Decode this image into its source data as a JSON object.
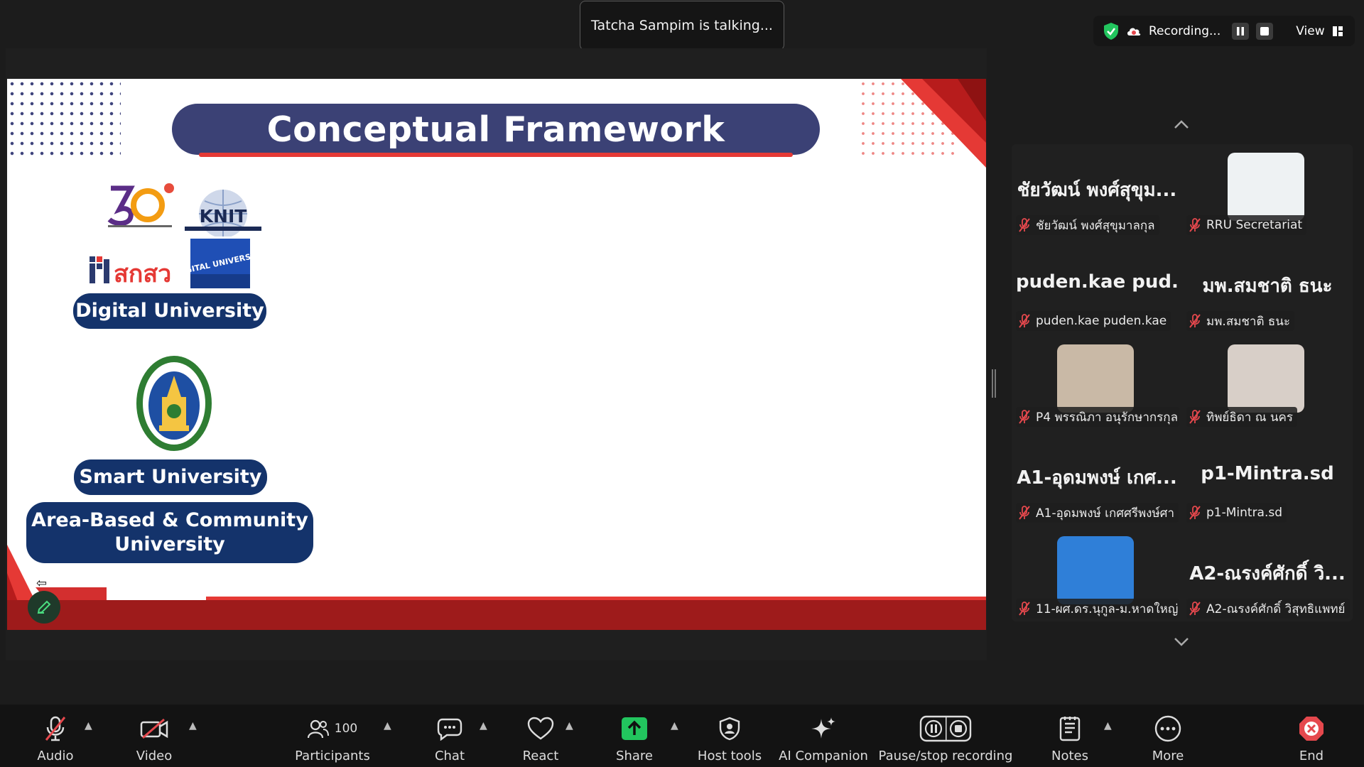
{
  "status": {
    "talking": "Tatcha Sampim is talking..."
  },
  "recording": {
    "label": "Recording...",
    "view_label": "View"
  },
  "slide": {
    "title": "Conceptual Framework",
    "logo_texts": {
      "knit": "KNIT",
      "dpu": "DIGITAL UNIVERSITY",
      "skl": "สกสว"
    },
    "pills": {
      "digital": "Digital University",
      "smart": "Smart University",
      "area_line1": "Area-Based & Community",
      "area_line2": "University"
    }
  },
  "gallery": {
    "tiles": [
      {
        "big": "ชัยวัฒน์ พงศ์สุขุม...",
        "label": "ชัยวัฒน์ พงศ์สุขุมาลกุล",
        "video": false
      },
      {
        "big": "",
        "label": "RRU Secretariat",
        "video": true,
        "thumb_color": "#eef2f3"
      },
      {
        "big": "puden.kae  pud...",
        "label": "puden.kae puden.kae",
        "video": false
      },
      {
        "big": "มพ.สมชาติ ธนะ",
        "label": "มพ.สมชาติ ธนะ",
        "video": false
      },
      {
        "big": "",
        "label": "P4 พรรณิภา อนุรักษากรกุล",
        "video": true,
        "thumb_color": "#c9b9a6"
      },
      {
        "big": "",
        "label": "ทิพย์ธิดา ณ นคร",
        "video": true,
        "thumb_color": "#d8cfc8"
      },
      {
        "big": "A1-อุดมพงษ์ เกศ...",
        "label": "A1-อุดมพงษ์ เกศศรีพงษ์ศา",
        "video": false
      },
      {
        "big": "p1-Mintra.sd",
        "label": "p1-Mintra.sd",
        "video": false
      },
      {
        "big": "",
        "label": "11-ผศ.ดร.นุกูล-ม.หาดใหญ่",
        "video": true,
        "thumb_color": "#2f7fd8"
      },
      {
        "big": "A2-ณรงค์ศักดิ์ วิ...",
        "label": "A2-ณรงค์ศักดิ์ วิสุทธิแพทย์",
        "video": false
      }
    ]
  },
  "toolbar": {
    "audio": "Audio",
    "video": "Video",
    "participants": "Participants",
    "participants_count": "100",
    "chat": "Chat",
    "react": "React",
    "share": "Share",
    "host_tools": "Host tools",
    "ai_companion": "AI Companion",
    "pause_stop": "Pause/stop recording",
    "notes": "Notes",
    "more": "More",
    "end": "End"
  },
  "colors": {
    "accent_green": "#22c55e",
    "end_red": "#e5484d",
    "slide_navy": "#14336b",
    "slide_red": "#e53935"
  }
}
